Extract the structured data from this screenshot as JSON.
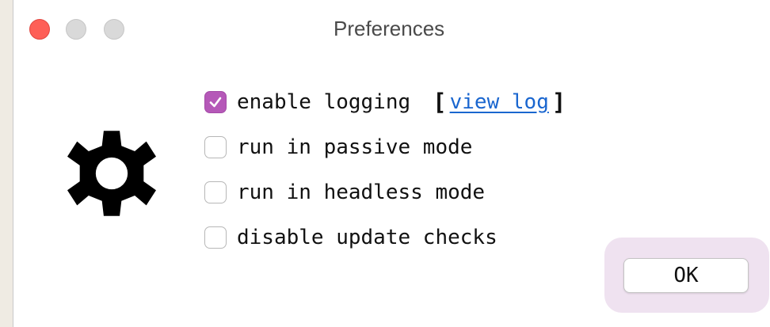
{
  "window": {
    "title": "Preferences"
  },
  "icons": {
    "close": "close-traffic-light",
    "minimize": "minimize-traffic-light",
    "maximize": "maximize-traffic-light",
    "settings": "gear-icon",
    "check": "checkmark-icon"
  },
  "options": [
    {
      "label": "enable logging",
      "checked": true
    },
    {
      "label": "run in passive mode",
      "checked": false
    },
    {
      "label": "run in headless mode",
      "checked": false
    },
    {
      "label": "disable update checks",
      "checked": false
    }
  ],
  "log_link": {
    "open_bracket": "[",
    "label": "view log",
    "close_bracket": "]"
  },
  "buttons": {
    "ok": "OK"
  },
  "colors": {
    "accent": "#b558b8",
    "link": "#1a66cf",
    "close": "#fe5f57",
    "focus_halo": "#efe2f0"
  }
}
